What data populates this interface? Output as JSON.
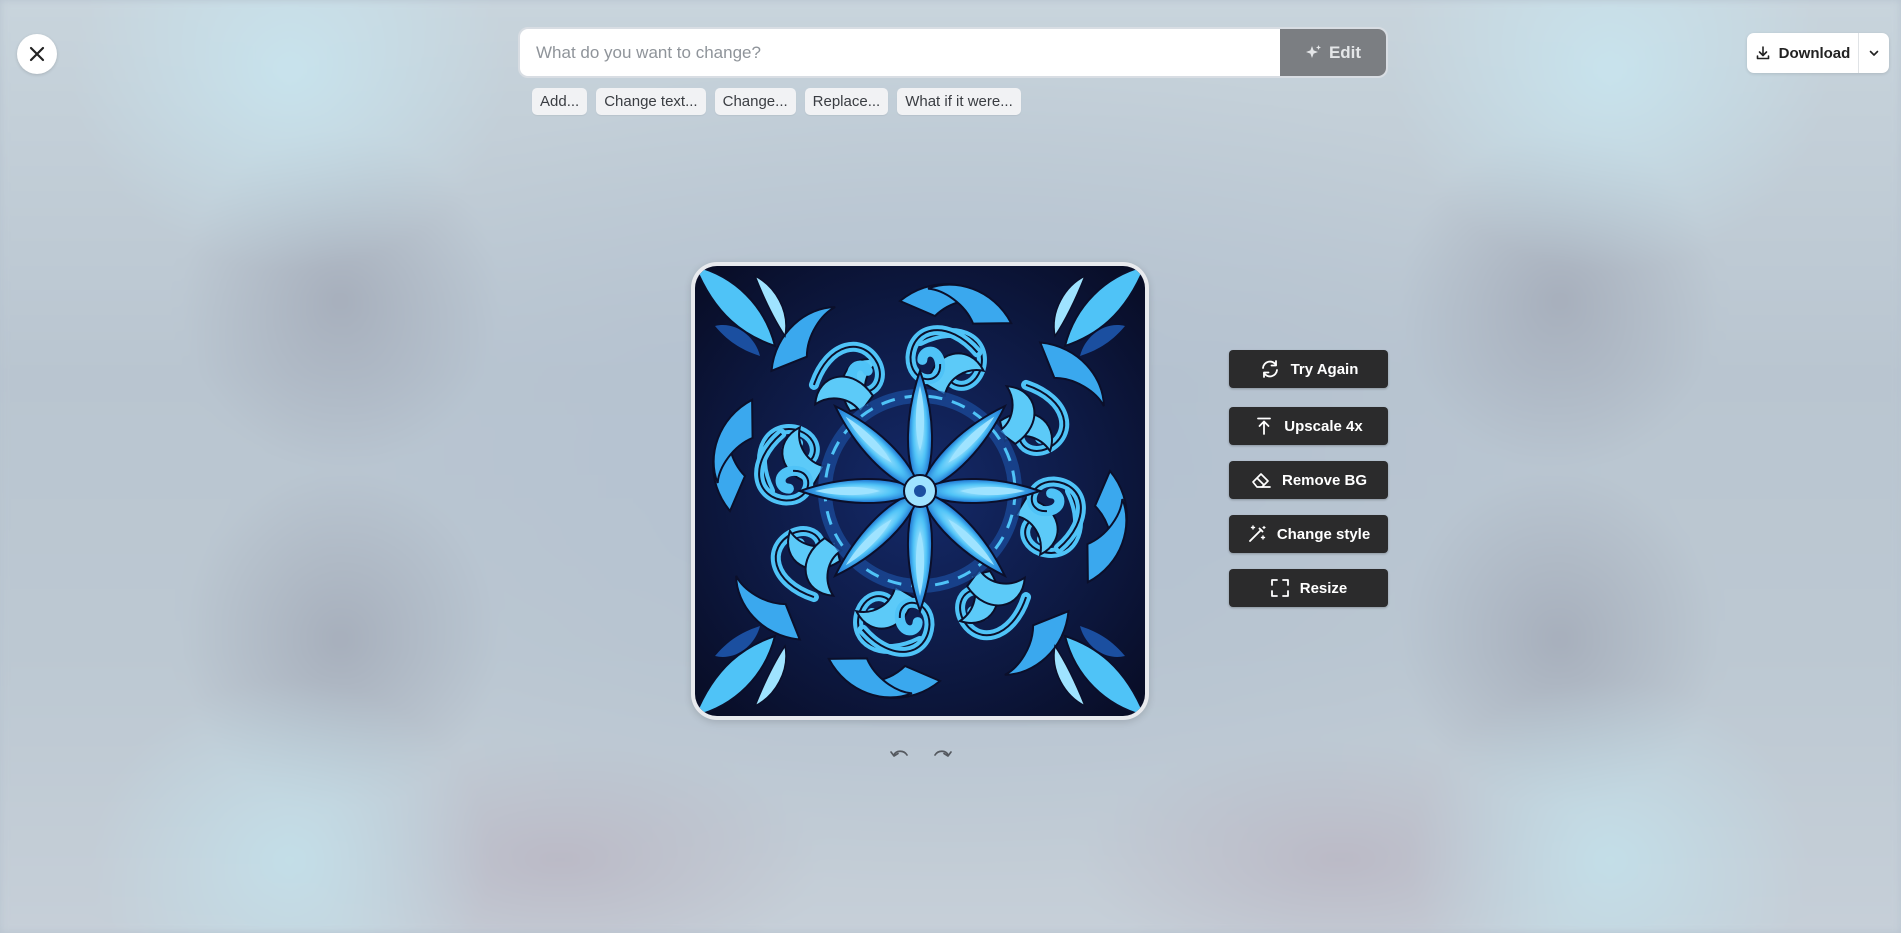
{
  "prompt": {
    "placeholder": "What do you want to change?",
    "value": "",
    "edit_label": "Edit"
  },
  "suggestions": [
    "Add...",
    "Change text...",
    "Change...",
    "Replace...",
    "What if it were..."
  ],
  "download": {
    "label": "Download"
  },
  "actions": [
    {
      "label": "Try Again",
      "icon": "refresh-icon"
    },
    {
      "label": "Upscale 4x",
      "icon": "upscale-icon"
    },
    {
      "label": "Remove BG",
      "icon": "eraser-icon"
    },
    {
      "label": "Change style",
      "icon": "magic-wand-icon"
    },
    {
      "label": "Resize",
      "icon": "resize-icon"
    }
  ],
  "image": {
    "description_icon": "kaleidoscope-image",
    "colors": {
      "dark": "#0b0f2a",
      "mid": "#1b4fa0",
      "light": "#4fc3f7",
      "highlight": "#9fe3ff"
    }
  },
  "history": {
    "undo_icon": "undo-icon",
    "redo_icon": "redo-icon"
  },
  "colors": {
    "action_bg": "#2b2b2c",
    "edit_bg": "#7b7e82"
  }
}
